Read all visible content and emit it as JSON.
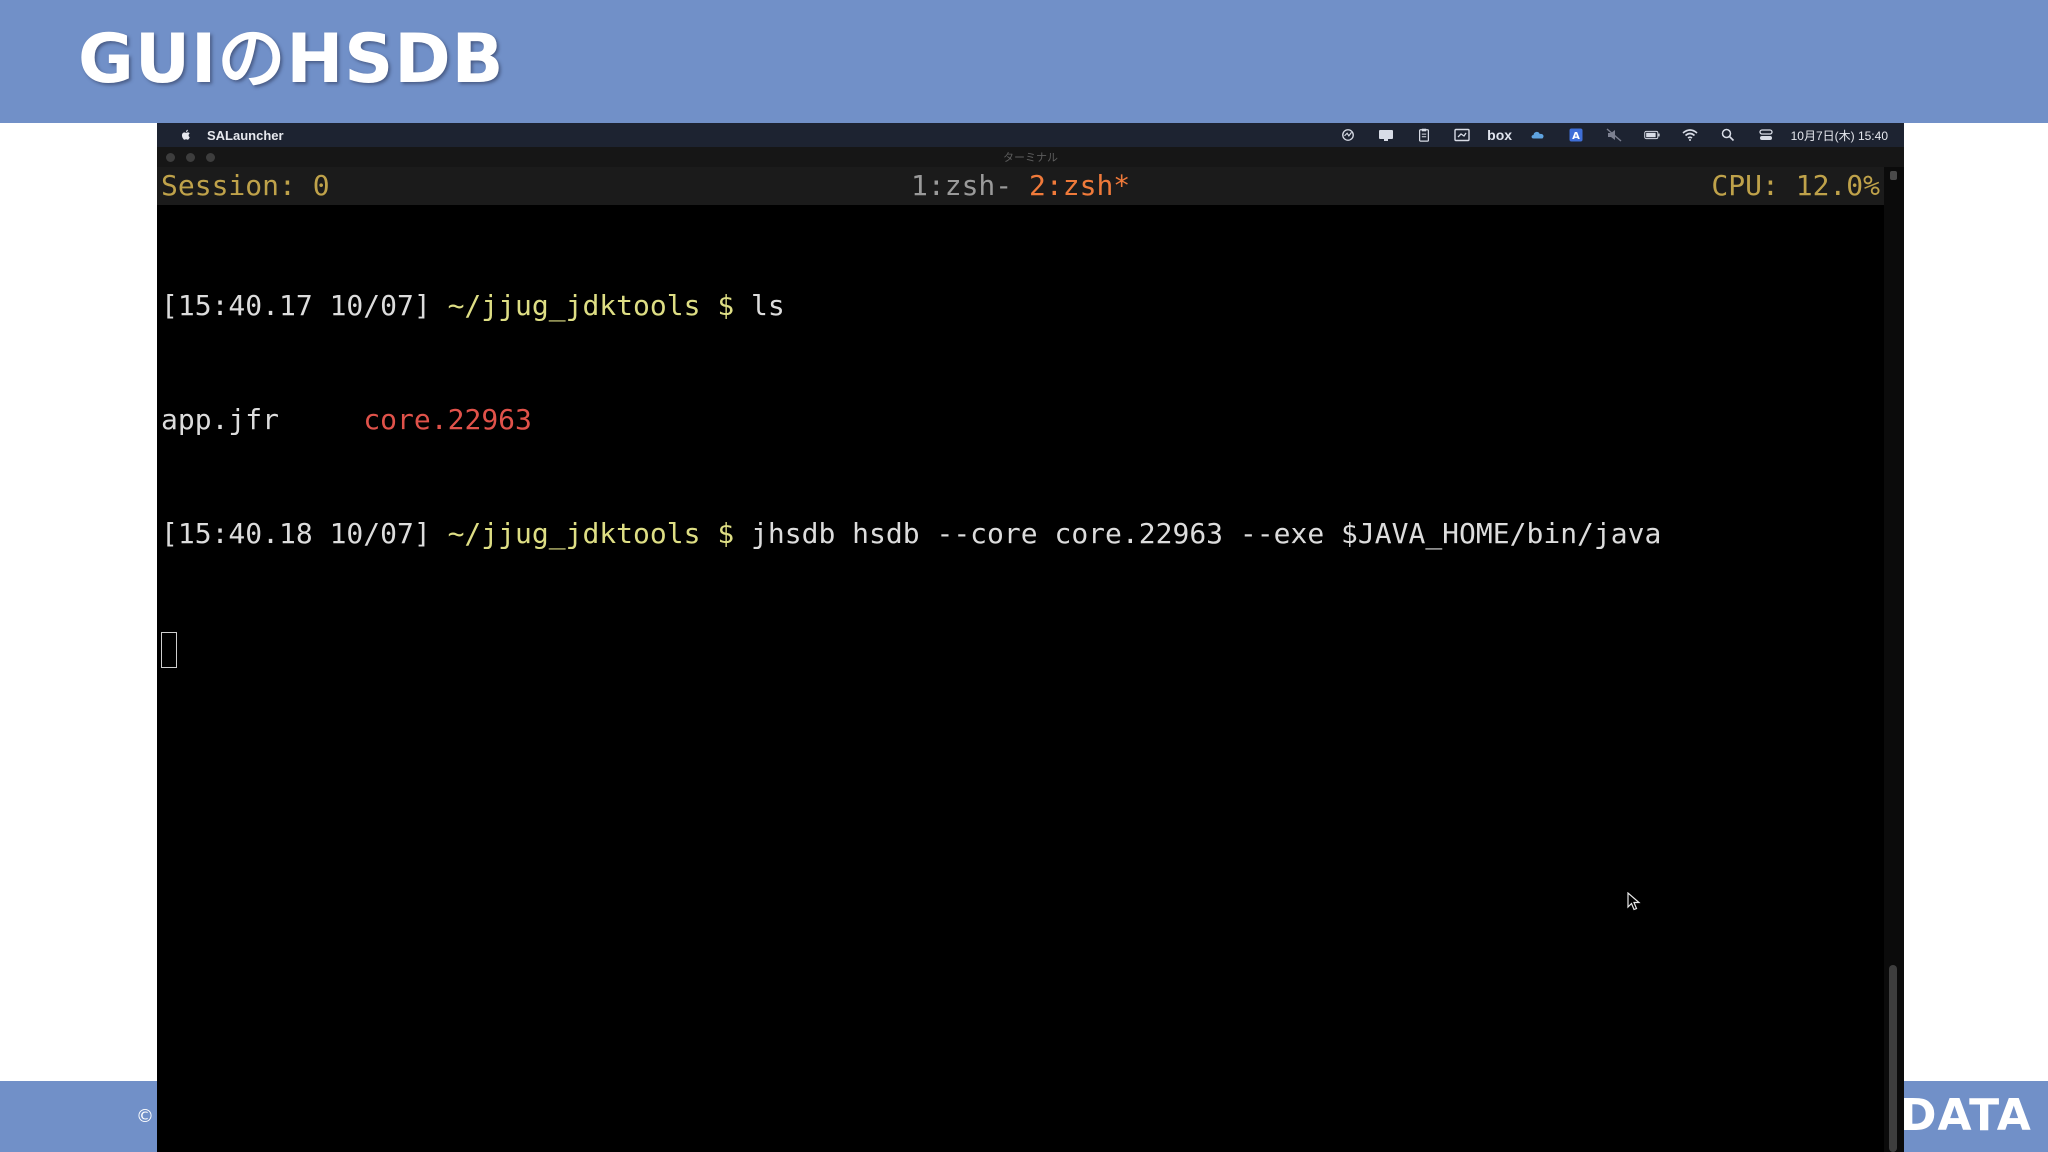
{
  "slide": {
    "title": "GUIのHSDB",
    "copyright": "©",
    "logo_text": "DATA"
  },
  "menubar": {
    "app_name": "SALauncher",
    "status_icons": [
      "activity-icon",
      "display-icon",
      "clipboard-icon",
      "screenshot-icon",
      "box-icon",
      "cloud-icon",
      "input-source-icon",
      "mute-icon",
      "battery-icon",
      "wifi-icon",
      "search-icon",
      "control-center-icon"
    ],
    "box_label": "box",
    "input_label": "A",
    "datetime": "10月7日(木) 15:40"
  },
  "window": {
    "title": "ターミナル"
  },
  "tmux": {
    "session": "Session: 0",
    "window_inactive": "1:zsh-",
    "window_active": "2:zsh*",
    "cpu": "CPU: 12.0%"
  },
  "terminal": {
    "prompt1": {
      "time": "[15:40.17 10/07]",
      "path": "~/jjug_jdktools",
      "symbol": "$",
      "command": "ls"
    },
    "ls_output": {
      "file1": "app.jfr",
      "file2": "core.22963"
    },
    "prompt2": {
      "time": "[15:40.18 10/07]",
      "path": "~/jjug_jdktools",
      "symbol": "$",
      "command": "jhsdb hsdb --core core.22963 --exe $JAVA_HOME/bin/java"
    }
  },
  "colors": {
    "slide_band": "#7190c8",
    "prompt_path": "#dede84",
    "core_file": "#e0524a",
    "tmux_accent": "#bfa24a",
    "tmux_active_window": "#f07a3a"
  }
}
